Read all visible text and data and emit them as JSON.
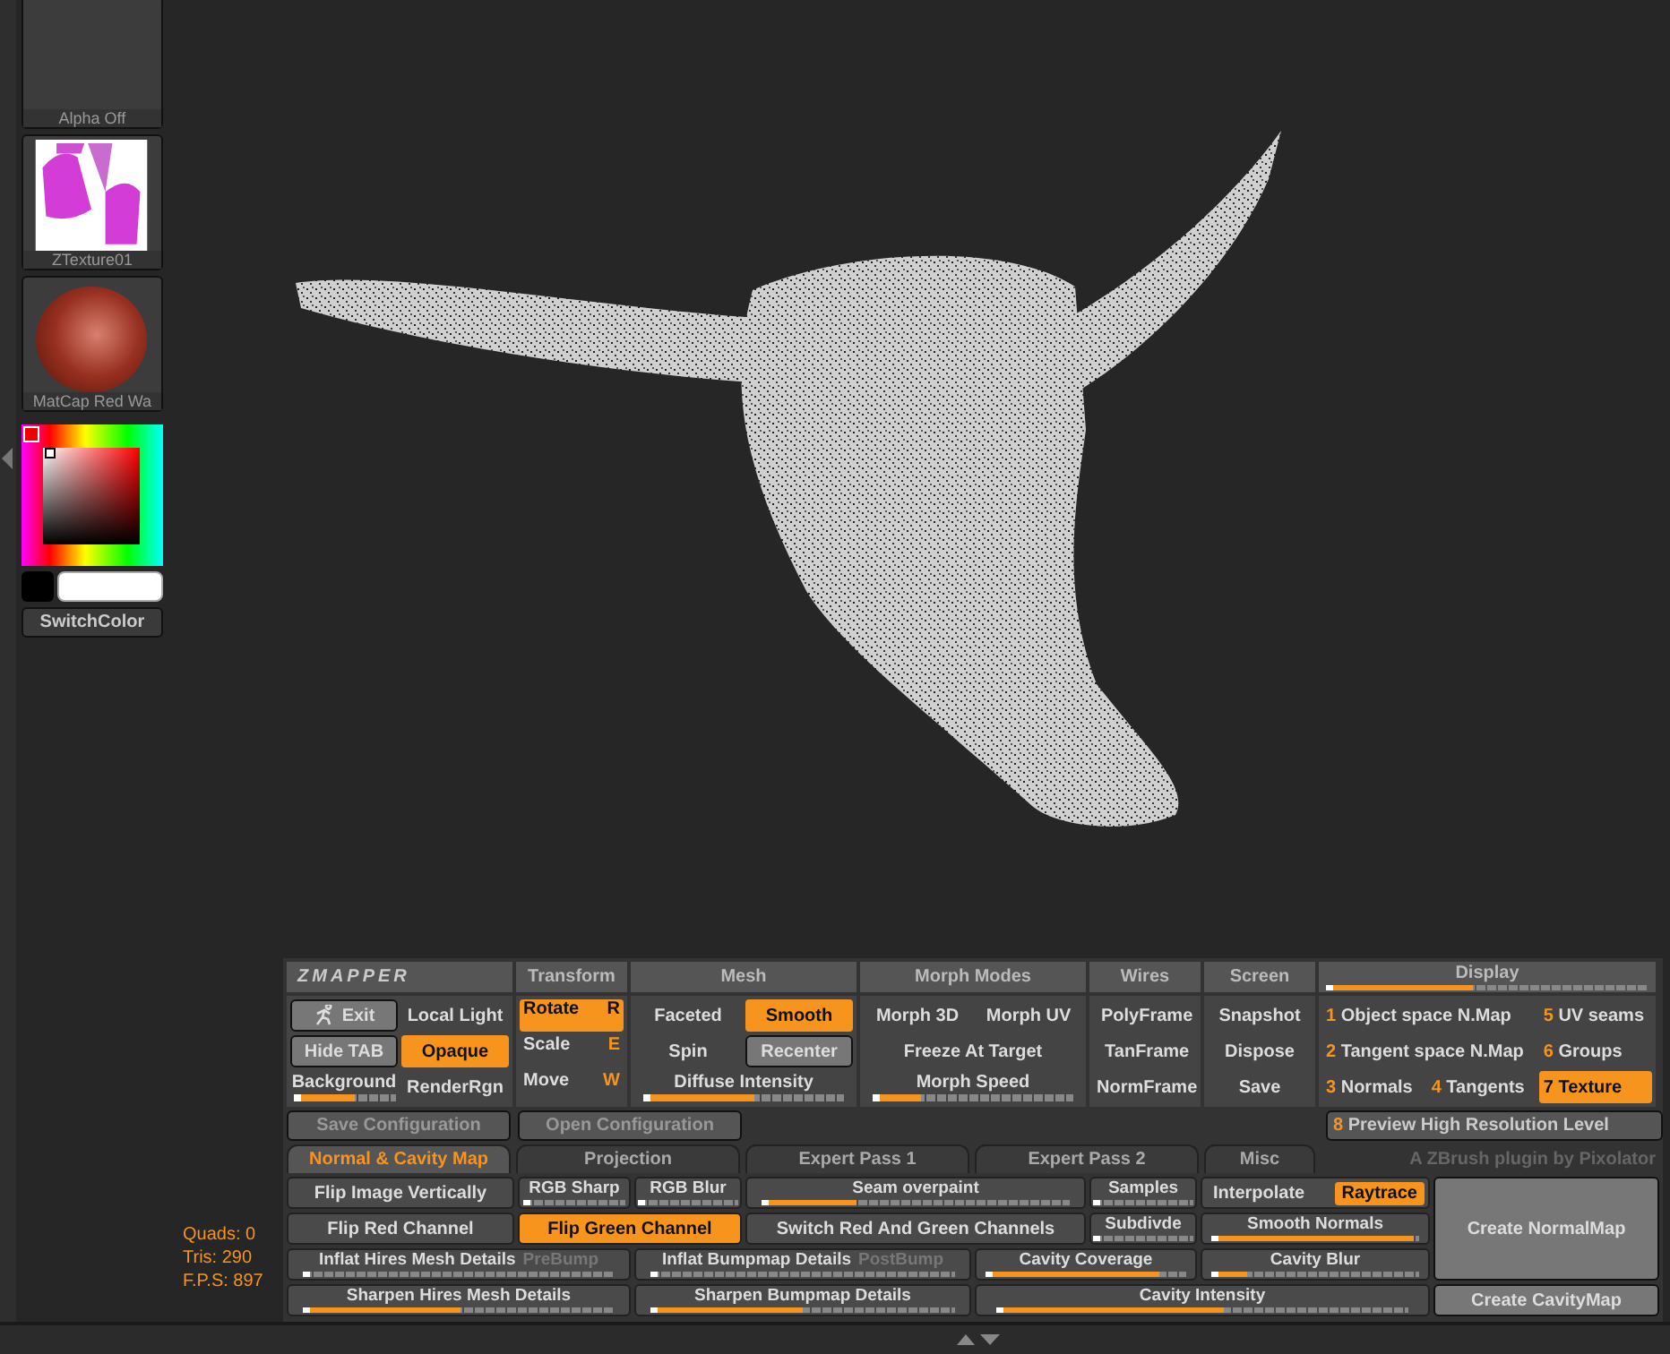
{
  "sidebar": {
    "alpha_label": "Alpha Off",
    "texture_label": "ZTexture01",
    "material_label": "MatCap Red Wa",
    "switch_button": "SwitchColor"
  },
  "stats": [
    "Quads: 0",
    "Tris: 290",
    "F.P.S: 897"
  ],
  "logo": "ZMAPPER",
  "main_controls": {
    "exit_button": "Exit",
    "local_light": {
      "label": "Local Light",
      "selected": false
    },
    "hide_tab_button": "Hide TAB",
    "opaque": {
      "label": "Opaque",
      "selected": true
    },
    "background": {
      "label": "Background",
      "level": 0.6
    },
    "render_region": {
      "label": "RenderRgn",
      "selected": false
    }
  },
  "transform": {
    "title": "Transform",
    "items": [
      {
        "label": "Rotate",
        "key": "R",
        "selected": true
      },
      {
        "label": "Scale",
        "key": "E",
        "selected": false
      },
      {
        "label": "Move",
        "key": "W",
        "selected": false
      }
    ]
  },
  "mesh": {
    "title": "Mesh",
    "faceted": {
      "label": "Faceted",
      "selected": false
    },
    "smooth": {
      "label": "Smooth",
      "selected": true
    },
    "spin_button": "Spin",
    "recenter_button": "Recenter",
    "diffuse": {
      "label": "Diffuse Intensity",
      "level": 0.55
    }
  },
  "morph": {
    "title": "Morph Modes",
    "items": [
      {
        "label": "Morph 3D",
        "selected": false
      },
      {
        "label": "Morph UV",
        "selected": false
      }
    ],
    "freeze_button": "Freeze At Target",
    "speed": {
      "label": "Morph Speed",
      "level": 0.22
    }
  },
  "wires": {
    "title": "Wires",
    "items": [
      {
        "label": "PolyFrame",
        "selected": false
      },
      {
        "label": "TanFrame",
        "selected": false
      },
      {
        "label": "NormFrame",
        "selected": false
      }
    ]
  },
  "screen": {
    "title": "Screen",
    "buttons": [
      "Snapshot",
      "Dispose",
      "Save"
    ]
  },
  "display": {
    "title": "Display",
    "level": 0.45,
    "items": [
      {
        "number": "1",
        "label": "Object space N.Map",
        "selected": false
      },
      {
        "number": "5",
        "label": "UV seams",
        "selected": false
      },
      {
        "number": "2",
        "label": "Tangent space N.Map",
        "selected": false
      },
      {
        "number": "6",
        "label": "Groups",
        "selected": false
      },
      {
        "number": "3",
        "label": "Normals",
        "selected": false
      },
      {
        "number": "4",
        "label": "Tangents",
        "selected": false
      },
      {
        "number": "7",
        "label": "Texture",
        "selected": true
      }
    ]
  },
  "config": {
    "save_button": "Save Configuration",
    "open_button": "Open Configuration",
    "preview": {
      "number": "8",
      "label": "Preview High Resolution Level",
      "selected": false
    }
  },
  "tabs": [
    {
      "label": "Normal & Cavity Map",
      "selected": true
    },
    {
      "label": "Projection",
      "selected": false
    },
    {
      "label": "Expert Pass 1",
      "selected": false
    },
    {
      "label": "Expert Pass 2",
      "selected": false
    },
    {
      "label": "Misc",
      "selected": false
    }
  ],
  "credit": "A ZBrush plugin by Pixolator",
  "controls": [
    {
      "kind": "toggle",
      "label": "Flip Image Vertically",
      "selected": false
    },
    {
      "kind": "slider",
      "label": "RGB Sharp",
      "level": 0
    },
    {
      "kind": "slider",
      "label": "RGB Blur",
      "level": 0
    },
    {
      "kind": "slider",
      "label": "Seam overpaint",
      "level": 0.3
    },
    {
      "kind": "slider",
      "label": "Samples",
      "level": 0
    },
    {
      "kind": "options",
      "options": [
        {
          "label": "Interpolate",
          "selected": false
        },
        {
          "label": "Raytrace",
          "selected": true
        }
      ]
    },
    {
      "kind": "toggle",
      "label": "Flip Red Channel",
      "selected": false
    },
    {
      "kind": "toggle",
      "label": "Flip Green Channel",
      "selected": true
    },
    {
      "kind": "toggle",
      "label": "Switch Red And Green Channels",
      "selected": false
    },
    {
      "kind": "slider",
      "label": "Subdivde",
      "level": 0
    },
    {
      "kind": "slider",
      "label": "Smooth Normals",
      "level": 1
    },
    {
      "kind": "slider",
      "label": "Inflat Hires Mesh Details",
      "suffix": "PreBump",
      "level": 0
    },
    {
      "kind": "slider",
      "label": "Inflat Bumpmap Details",
      "suffix": "PostBump",
      "level": 0
    },
    {
      "kind": "slider",
      "label": "Cavity Coverage",
      "level": 0.88
    },
    {
      "kind": "slider",
      "label": "Cavity Blur",
      "level": 0.15
    },
    {
      "kind": "slider",
      "label": "Sharpen Hires Mesh Details",
      "level": 0.5
    },
    {
      "kind": "slider",
      "label": "Sharpen Bumpmap Details",
      "level": 0.5
    },
    {
      "kind": "slider",
      "label": "Cavity Intensity",
      "level": 0.55
    }
  ],
  "create_normal_button": "Create NormalMap",
  "create_cavity_button": "Create CavityMap"
}
